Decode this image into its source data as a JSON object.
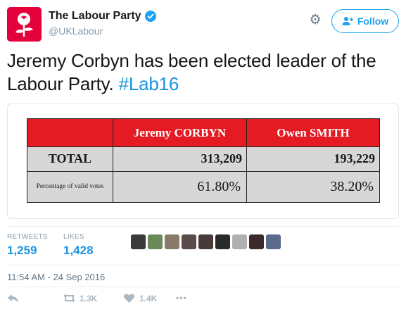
{
  "account": {
    "display_name": "The Labour Party",
    "handle": "@UKLabour",
    "verified": true,
    "brand_color": "#e4003b"
  },
  "header_actions": {
    "settings_icon": "gear-icon",
    "follow_label": "Follow"
  },
  "tweet": {
    "text": "Jeremy Corbyn has been elected leader of the Labour Party.",
    "hashtag": "#Lab16"
  },
  "results_table": {
    "header_color": "#e41b23",
    "candidates": [
      "Jeremy CORBYN",
      "Owen SMITH"
    ],
    "rows": [
      {
        "label": "TOTAL",
        "values": [
          "313,209",
          "193,229"
        ]
      },
      {
        "label": "Percentage of valid votes",
        "values": [
          "61.80%",
          "38.20%"
        ]
      }
    ]
  },
  "stats": {
    "retweets_label": "RETWEETS",
    "retweets_value": "1,259",
    "likes_label": "LIKES",
    "likes_value": "1,428"
  },
  "liker_avatars": [
    "#3a3a3a",
    "#6a8a5a",
    "#8a7a6a",
    "#5a4a4a",
    "#4a3a3a",
    "#2a2a2a",
    "#b0b0b0",
    "#3a2a2a",
    "#5a6a8a"
  ],
  "timestamp": "11:54 AM - 24 Sep 2016",
  "actions": {
    "reply_icon": "reply-icon",
    "retweet_icon": "retweet-icon",
    "retweet_count": "1.3K",
    "like_icon": "heart-icon",
    "like_count": "1.4K",
    "more_icon": "more-icon",
    "more_label": "•••"
  }
}
